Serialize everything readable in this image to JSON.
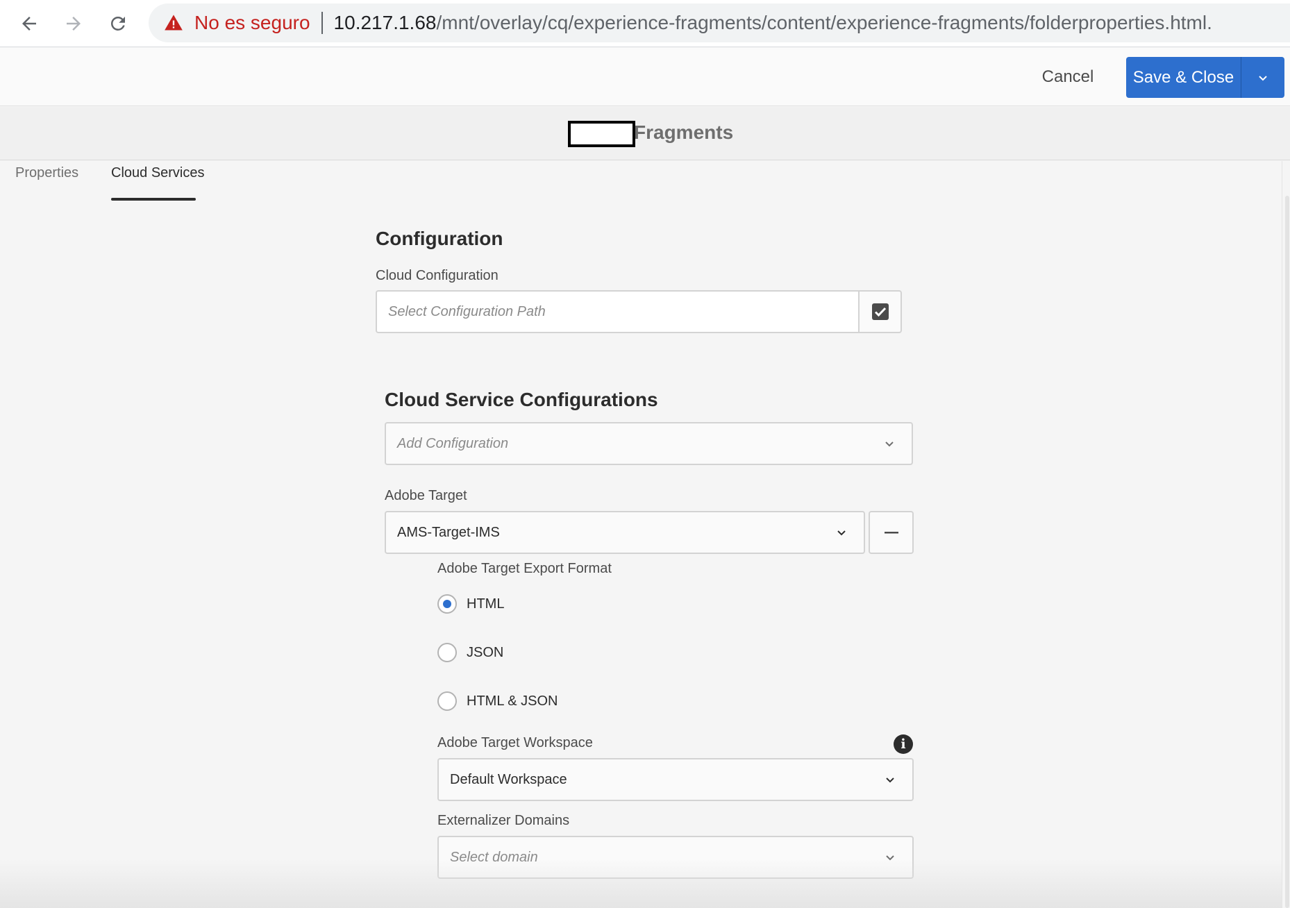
{
  "browser": {
    "not_secure_label": "No es seguro",
    "url_host": "10.217.1.68",
    "url_path": "/mnt/overlay/cq/experience-fragments/content/experience-fragments/folderproperties.html."
  },
  "actions": {
    "cancel_label": "Cancel",
    "save_label": "Save & Close"
  },
  "title": {
    "visible_text": "Fragments"
  },
  "tabs": [
    {
      "label": "Properties",
      "active": false
    },
    {
      "label": "Cloud Services",
      "active": true
    }
  ],
  "configuration": {
    "heading": "Configuration",
    "cloud_config_label": "Cloud Configuration",
    "cloud_config_placeholder": "Select Configuration Path"
  },
  "cloud_services": {
    "heading": "Cloud Service Configurations",
    "add_placeholder": "Add Configuration",
    "target_label": "Adobe Target",
    "target_value": "AMS-Target-IMS",
    "export_format_label": "Adobe Target Export Format",
    "export_options": [
      {
        "label": "HTML",
        "checked": true
      },
      {
        "label": "JSON",
        "checked": false
      },
      {
        "label": "HTML & JSON",
        "checked": false
      }
    ],
    "workspace_label": "Adobe Target Workspace",
    "workspace_value": "Default Workspace",
    "domains_label": "Externalizer Domains",
    "domains_placeholder": "Select domain"
  },
  "colors": {
    "primary": "#2d6fce",
    "not_secure": "#c5221f"
  }
}
